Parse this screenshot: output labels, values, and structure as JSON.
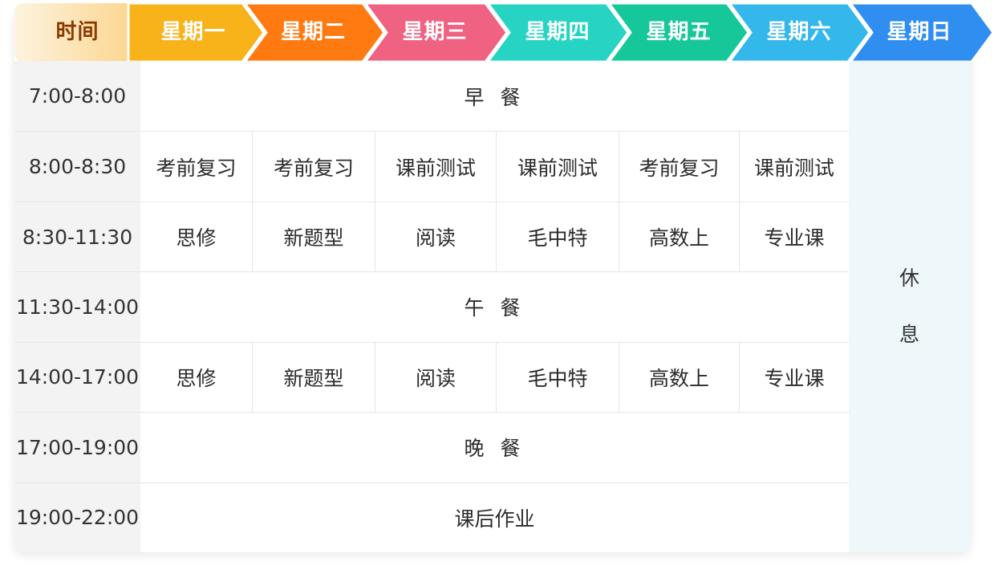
{
  "header": {
    "time_label": "时间",
    "days": [
      "星期一",
      "星期二",
      "星期三",
      "星期四",
      "星期五",
      "星期六",
      "星期日"
    ],
    "colors": [
      "#f8b21a",
      "#ff7a10",
      "#ef6281",
      "#27d3c3",
      "#16c79a",
      "#34b7ea",
      "#2f8ef0"
    ],
    "time_color_start": "#fdf3df",
    "time_color_end": "#fbd48a"
  },
  "rows": [
    {
      "time": "7:00-8:00",
      "merged": "早 餐"
    },
    {
      "time": "8:00-8:30",
      "cells": [
        "考前复习",
        "考前复习",
        "课前测试",
        "课前测试",
        "考前复习",
        "课前测试"
      ]
    },
    {
      "time": "8:30-11:30",
      "cells": [
        "思修",
        "新题型",
        "阅读",
        "毛中特",
        "高数上",
        "专业课"
      ]
    },
    {
      "time": "11:30-14:00",
      "merged": "午 餐"
    },
    {
      "time": "14:00-17:00",
      "cells": [
        "思修",
        "新题型",
        "阅读",
        "毛中特",
        "高数上",
        "专业课"
      ]
    },
    {
      "time": "17:00-19:00",
      "merged": "晚 餐"
    },
    {
      "time": "19:00-22:00",
      "merged": "课后作业"
    }
  ],
  "sunday": {
    "line1": "休",
    "line2": "息"
  }
}
